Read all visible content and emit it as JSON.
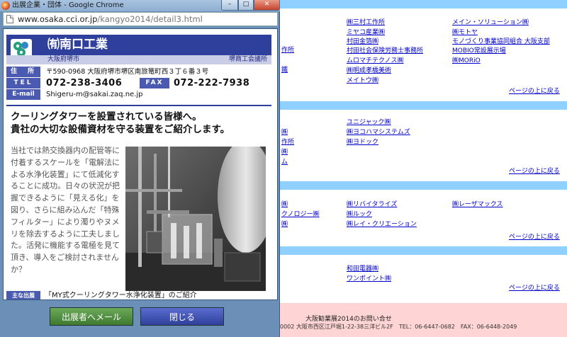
{
  "window": {
    "title": "出展企業・団体 - Google Chrome",
    "min_glyph": "–",
    "max_glyph": "□",
    "close_glyph": "✕"
  },
  "url": {
    "host": "www.osaka.cci.or.jp",
    "path": "/kangyo2014/detail3.html"
  },
  "company": {
    "name": "㈲南口工業",
    "region": "大阪府堺市",
    "chamber": "堺商工会議所",
    "address_label": "住　所",
    "address": "〒590-0968 大阪府堺市堺区南旅篭町西３丁６番３号",
    "tel_label": "TEL",
    "tel": "072-238-3406",
    "fax_label": "FAX",
    "fax": "072-222-7938",
    "email_label": "E-mail",
    "email": "Shigeru-m@sakai.zaq.ne.jp"
  },
  "article": {
    "headline_1": "クーリングタワーを設置されている皆様へ。",
    "headline_2": "貴社の大切な設備資材を守る装置をご紹介します。",
    "body": "当社では熱交換器内の配管等に付着するスケールを「電解法による水浄化装置」にて低減化することに成功。日々の状況が把握できるように「見える化」を図り、さらに組み込んだ「特殊フィルター」により濁りやヌメリを除去するように工夫しました。活発に機能する電極を見て頂き、導入をご検討されませんか？",
    "exhibit_label": "主な出展",
    "exhibit": "「MY式クーリングタワー水浄化装置」のご紹介"
  },
  "buttons": {
    "mail": "出展者へメール",
    "close": "閉じる"
  },
  "background": {
    "col1": [
      {
        "text": "作所"
      },
      {
        "text": "鐵"
      }
    ],
    "sec1_col2": [
      "㈱三村工作所",
      "ミヤコ産業㈱",
      "村田金箔㈱",
      "村田社会保険労務士事務所",
      "ムロマチテクノス㈱",
      "㈱明成孝橋美術",
      "メイトウ㈱"
    ],
    "sec1_col3": [
      "メイン・ソリューション㈱",
      "㈱モトヤ",
      "モノづくり事業協同組合 大阪支部",
      "MOBIO常設展示場",
      "㈱MORiO"
    ],
    "sec2_col1": [
      "㈱",
      "㈱",
      "作所",
      "ム"
    ],
    "sec2_col2": [
      "ユニジャック㈱",
      "㈱ヨコハマシステムズ",
      "㈱ヨドック"
    ],
    "sec3_col1": [
      "㈱",
      "クノロジー㈱",
      "㈱"
    ],
    "sec3_col2": [
      "㈱リバイタライズ",
      "㈱ルック",
      "㈱レイ・クリエーション"
    ],
    "sec3_col3": [
      "㈱レーザマックス"
    ],
    "sec4_col2": [
      "和田電器㈱",
      "ワンポイント㈱"
    ],
    "to_top": "ページの上に戻る",
    "footer_title": "大阪勧業展2014のお問い合せ",
    "footer_address": "0002 大阪市西区江戸堀1-22-38三洋ビル2F　TEL：06-6447-0682　FAX：06-6448-2049"
  }
}
